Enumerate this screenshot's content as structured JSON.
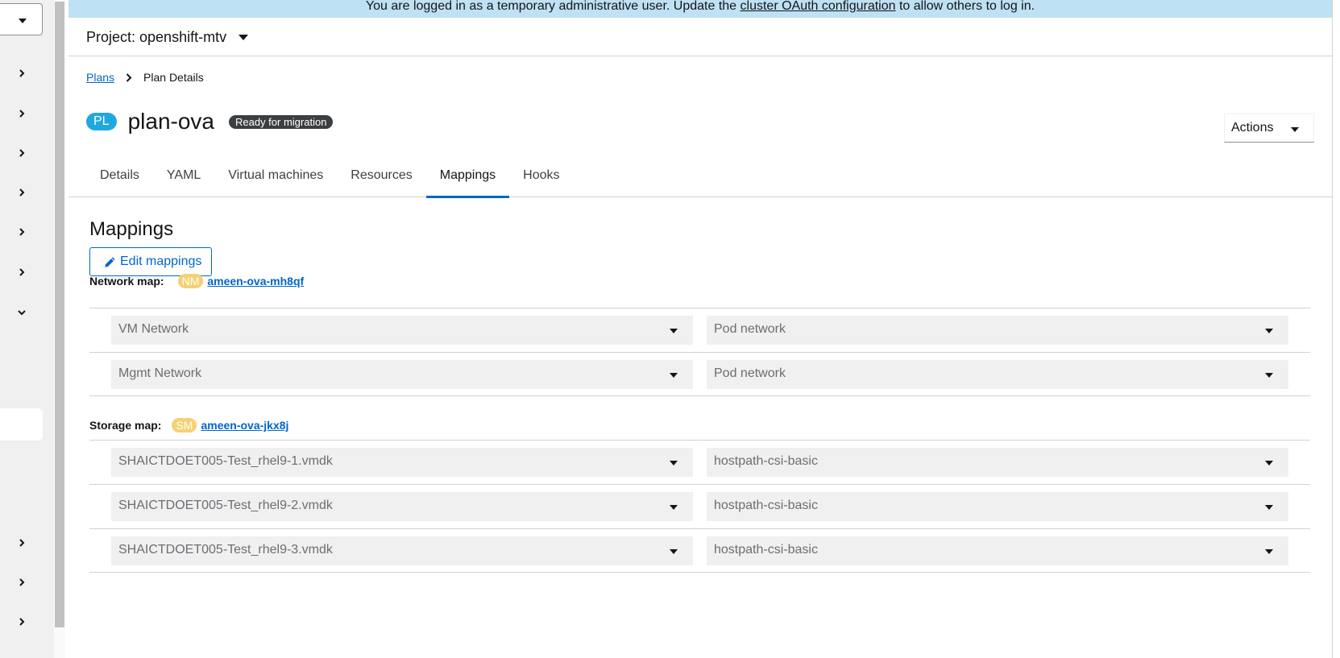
{
  "banner": {
    "text_before": "You are logged in as a temporary administrative user. Update the",
    "link": "cluster OAuth configuration",
    "text_after": "to allow others to log in."
  },
  "project": {
    "label": "Project: openshift-mtv"
  },
  "breadcrumb": {
    "parent": "Plans",
    "current": "Plan Details"
  },
  "header": {
    "badge": "PL",
    "title": "plan-ova",
    "status": "Ready for migration",
    "actions_label": "Actions"
  },
  "tabs": [
    "Details",
    "YAML",
    "Virtual machines",
    "Resources",
    "Mappings",
    "Hooks"
  ],
  "active_tab": "Mappings",
  "mappings": {
    "title": "Mappings",
    "edit_label": "Edit mappings",
    "network_map": {
      "label": "Network map:",
      "badge": "NM",
      "name": "ameen-ova-mh8qf",
      "rows": [
        {
          "source": "VM Network",
          "target": "Pod network"
        },
        {
          "source": "Mgmt Network",
          "target": "Pod network"
        }
      ]
    },
    "storage_map": {
      "label": "Storage map:",
      "badge": "SM",
      "name": "ameen-ova-jkx8j",
      "rows": [
        {
          "source": "SHAICTDOET005-Test_rhel9-1.vmdk",
          "target": "hostpath-csi-basic"
        },
        {
          "source": "SHAICTDOET005-Test_rhel9-2.vmdk",
          "target": "hostpath-csi-basic"
        },
        {
          "source": "SHAICTDOET005-Test_rhel9-3.vmdk",
          "target": "hostpath-csi-basic"
        }
      ]
    }
  }
}
